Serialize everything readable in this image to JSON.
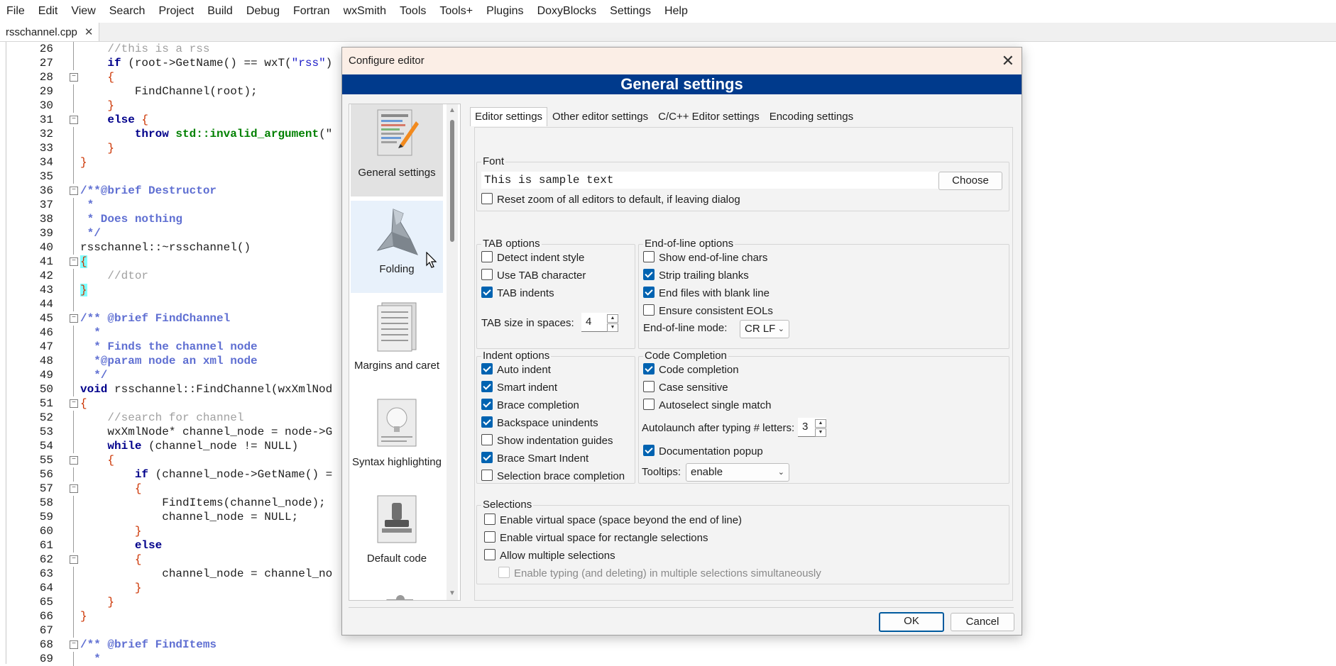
{
  "menubar": [
    "File",
    "Edit",
    "View",
    "Search",
    "Project",
    "Build",
    "Debug",
    "Fortran",
    "wxSmith",
    "Tools",
    "Tools+",
    "Plugins",
    "DoxyBlocks",
    "Settings",
    "Help"
  ],
  "filetab": {
    "label": "rsschannel.cpp",
    "close": "✕"
  },
  "editor_lines": [
    {
      "n": "26",
      "t": "cm",
      "code": "    //this is a rss"
    },
    {
      "n": "27",
      "t": "mix27",
      "code": ""
    },
    {
      "n": "28",
      "t": "brace",
      "code": "    {"
    },
    {
      "n": "29",
      "t": "plain",
      "code": "        FindChannel(root);"
    },
    {
      "n": "30",
      "t": "brace",
      "code": "    }"
    },
    {
      "n": "31",
      "t": "kwbrace",
      "code": "    else {"
    },
    {
      "n": "32",
      "t": "mix32",
      "code": ""
    },
    {
      "n": "33",
      "t": "brace",
      "code": "    }"
    },
    {
      "n": "34",
      "t": "brace",
      "code": "}"
    },
    {
      "n": "35",
      "t": "plain",
      "code": ""
    },
    {
      "n": "36",
      "t": "doc",
      "code": "/**@brief Destructor"
    },
    {
      "n": "37",
      "t": "doc",
      "code": " *"
    },
    {
      "n": "38",
      "t": "doc",
      "code": " * Does nothing"
    },
    {
      "n": "39",
      "t": "doc",
      "code": " */"
    },
    {
      "n": "40",
      "t": "plain",
      "code": "rsschannel::~rsschannel()"
    },
    {
      "n": "41",
      "t": "hlbrace",
      "code": "{"
    },
    {
      "n": "42",
      "t": "cm",
      "code": "    //dtor"
    },
    {
      "n": "43",
      "t": "hlbrace",
      "code": "}"
    },
    {
      "n": "44",
      "t": "plain",
      "code": ""
    },
    {
      "n": "45",
      "t": "doc",
      "code": "/** @brief FindChannel"
    },
    {
      "n": "46",
      "t": "doc",
      "code": "  *"
    },
    {
      "n": "47",
      "t": "doc",
      "code": "  * Finds the channel node"
    },
    {
      "n": "48",
      "t": "doc",
      "code": "  *@param node an xml node"
    },
    {
      "n": "49",
      "t": "doc",
      "code": "  */"
    },
    {
      "n": "50",
      "t": "mix50",
      "code": ""
    },
    {
      "n": "51",
      "t": "brace",
      "code": "{"
    },
    {
      "n": "52",
      "t": "cm",
      "code": "    //search for channel"
    },
    {
      "n": "53",
      "t": "plain",
      "code": "    wxXmlNode* channel_node = node->G"
    },
    {
      "n": "54",
      "t": "mix54",
      "code": ""
    },
    {
      "n": "55",
      "t": "brace",
      "code": "    {"
    },
    {
      "n": "56",
      "t": "mix56",
      "code": ""
    },
    {
      "n": "57",
      "t": "brace",
      "code": "        {"
    },
    {
      "n": "58",
      "t": "plain",
      "code": "            FindItems(channel_node);"
    },
    {
      "n": "59",
      "t": "plain",
      "code": "            channel_node = NULL;"
    },
    {
      "n": "60",
      "t": "brace",
      "code": "        }"
    },
    {
      "n": "61",
      "t": "kw",
      "code": "        else"
    },
    {
      "n": "62",
      "t": "brace",
      "code": "        {"
    },
    {
      "n": "63",
      "t": "plain",
      "code": "            channel_node = channel_no"
    },
    {
      "n": "64",
      "t": "brace",
      "code": "        }"
    },
    {
      "n": "65",
      "t": "brace",
      "code": "    }"
    },
    {
      "n": "66",
      "t": "brace",
      "code": "}"
    },
    {
      "n": "67",
      "t": "plain",
      "code": ""
    },
    {
      "n": "68",
      "t": "doc",
      "code": "/** @brief FindItems"
    },
    {
      "n": "69",
      "t": "doc",
      "code": "  *"
    }
  ],
  "code_parts": {
    "l27_kw": "if",
    "l27_a": " (root->GetName() == wxT(",
    "l27_str": "\"rss\"",
    "l27_b": ")",
    "l32_kw": "throw",
    "l32_ns": " std::invalid_argument",
    "l32_b": "(\"",
    "l50_kw": "void",
    "l50_rest": " rsschannel::FindChannel(wxXmlNod",
    "l54_kw": "while",
    "l54_rest": " (channel_node != NULL)",
    "l56_kw": "if",
    "l56_rest": " (channel_node->GetName() ="
  },
  "dialog": {
    "title": "Configure editor",
    "close": "✕",
    "banner": "General settings",
    "sidebar": [
      {
        "label": "General settings",
        "icon": "general-settings-icon"
      },
      {
        "label": "Folding",
        "icon": "folding-icon"
      },
      {
        "label": "Margins and caret",
        "icon": "margins-icon"
      },
      {
        "label": "Syntax highlighting",
        "icon": "syntax-icon"
      },
      {
        "label": "Default code",
        "icon": "default-code-icon"
      }
    ],
    "tabs": [
      "Editor settings",
      "Other editor settings",
      "C/C++ Editor settings",
      "Encoding settings"
    ],
    "font": {
      "label": "Font",
      "sample": "This is sample text",
      "choose": "Choose",
      "reset_zoom": "Reset zoom of all editors to default, if leaving dialog"
    },
    "tab_options": {
      "label": "TAB options",
      "items": [
        {
          "label": "Detect indent style",
          "checked": false
        },
        {
          "label": "Use TAB character",
          "checked": false
        },
        {
          "label": "TAB indents",
          "checked": true
        }
      ],
      "size_label": "TAB size in spaces:",
      "size_value": "4"
    },
    "eol_options": {
      "label": "End-of-line options",
      "items": [
        {
          "label": "Show end-of-line chars",
          "checked": false
        },
        {
          "label": "Strip trailing blanks",
          "checked": true
        },
        {
          "label": "End files with blank line",
          "checked": true
        },
        {
          "label": "Ensure consistent EOLs",
          "checked": false
        }
      ],
      "mode_label": "End-of-line mode:",
      "mode_value": "CR LF"
    },
    "indent_options": {
      "label": "Indent options",
      "items": [
        {
          "label": "Auto indent",
          "checked": true
        },
        {
          "label": "Smart indent",
          "checked": true
        },
        {
          "label": "Brace completion",
          "checked": true
        },
        {
          "label": "Backspace unindents",
          "checked": true
        },
        {
          "label": "Show indentation guides",
          "checked": false
        },
        {
          "label": "Brace Smart Indent",
          "checked": true
        },
        {
          "label": "Selection brace completion",
          "checked": false
        }
      ]
    },
    "code_completion": {
      "label": "Code Completion",
      "items": [
        {
          "label": "Code completion",
          "checked": true
        },
        {
          "label": "Case sensitive",
          "checked": false
        },
        {
          "label": "Autoselect single match",
          "checked": false
        }
      ],
      "autolaunch_label": "Autolaunch after typing # letters:",
      "autolaunch_value": "3",
      "doc_popup": {
        "label": "Documentation popup",
        "checked": true
      },
      "tooltips_label": "Tooltips:",
      "tooltips_value": "enable"
    },
    "selections": {
      "label": "Selections",
      "items": [
        {
          "label": "Enable virtual space (space beyond the end of line)",
          "checked": false
        },
        {
          "label": "Enable virtual space for rectangle selections",
          "checked": false
        },
        {
          "label": "Allow multiple selections",
          "checked": false
        },
        {
          "label": "Enable typing (and deleting) in multiple selections simultaneously",
          "checked": false,
          "disabled": true
        }
      ]
    },
    "ok": "OK",
    "cancel": "Cancel"
  }
}
